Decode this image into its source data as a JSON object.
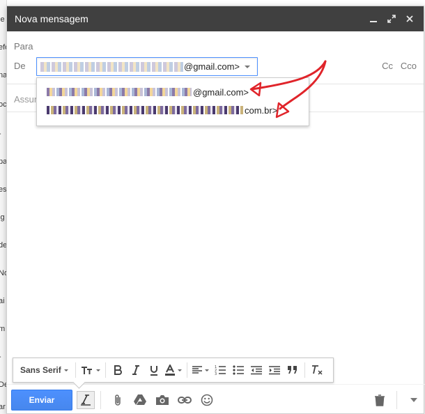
{
  "window": {
    "title": "Nova mensagem"
  },
  "fields": {
    "para_label": "Para",
    "de_label": "De",
    "from_domain": "@gmail.com>",
    "cc_label": "Cc",
    "cco_label": "Cco",
    "subject_placeholder": "Assunto"
  },
  "from_options": [
    {
      "domain": "@gmail.com>"
    },
    {
      "domain": "com.br>"
    }
  ],
  "format_toolbar": {
    "font_label": "Sans Serif"
  },
  "actions": {
    "send_label": "Enviar"
  },
  "background_fragments": [
    "le",
    "efo",
    "na",
    "oc",
    "-",
    "pa",
    "es",
    "ig",
    "de",
    "No",
    "ai",
    "m",
    "-",
    "De",
    "ar"
  ],
  "colors": {
    "titlebar": "#404040",
    "send_button": "#4d90fe",
    "annotation_arrow": "#e0242a",
    "focus_border": "#4d90fe"
  }
}
